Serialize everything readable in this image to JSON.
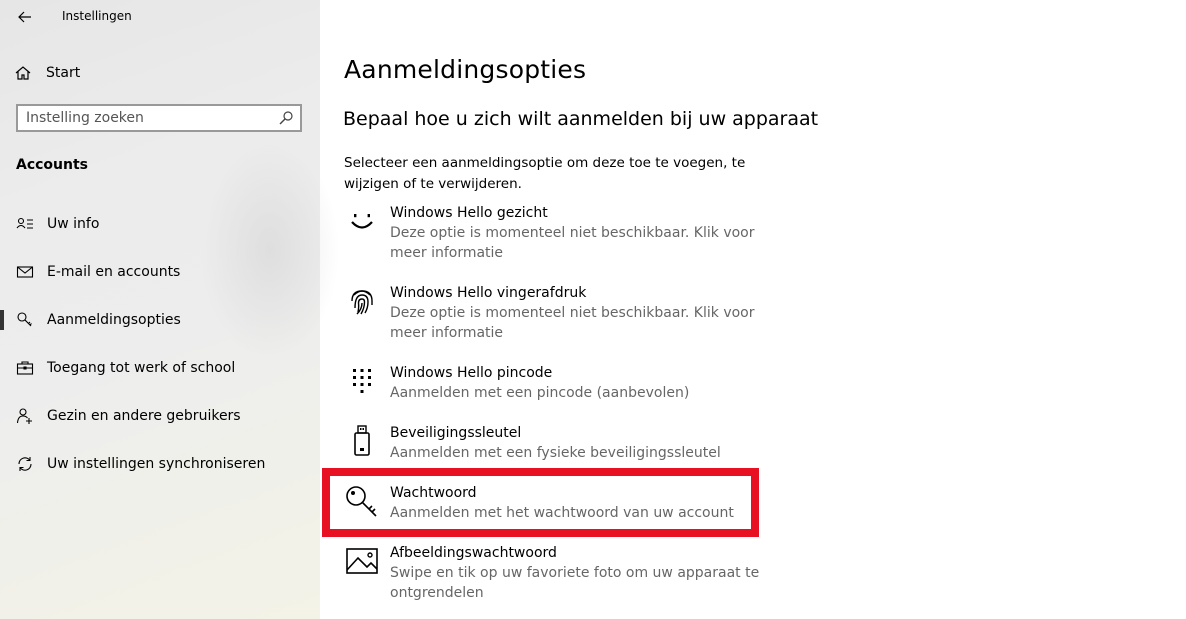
{
  "window": {
    "title": "Instellingen"
  },
  "sidebar": {
    "home_label": "Start",
    "search_placeholder": "Instelling zoeken",
    "section_title": "Accounts",
    "items": [
      {
        "label": "Uw info",
        "icon": "person-list-icon"
      },
      {
        "label": "E-mail en accounts",
        "icon": "mail-icon"
      },
      {
        "label": "Aanmeldingsopties",
        "icon": "key-icon",
        "active": true
      },
      {
        "label": "Toegang tot werk of school",
        "icon": "briefcase-icon"
      },
      {
        "label": "Gezin en andere gebruikers",
        "icon": "person-add-icon"
      },
      {
        "label": "Uw instellingen synchroniseren",
        "icon": "sync-icon"
      }
    ]
  },
  "main": {
    "title": "Aanmeldingsopties",
    "subtitle": "Bepaal hoe u zich wilt aanmelden bij uw apparaat",
    "description": "Selecteer een aanmeldingsoptie om deze toe te voegen, te wijzigen of te verwijderen.",
    "options": [
      {
        "title": "Windows Hello gezicht",
        "subtitle": "Deze optie is momenteel niet beschikbaar. Klik voor meer informatie",
        "icon": "smiley-face-icon"
      },
      {
        "title": "Windows Hello vingerafdruk",
        "subtitle": "Deze optie is momenteel niet beschikbaar. Klik voor meer informatie",
        "icon": "fingerprint-icon"
      },
      {
        "title": "Windows Hello pincode",
        "subtitle": "Aanmelden met een pincode (aanbevolen)",
        "icon": "keypad-icon"
      },
      {
        "title": "Beveiligingssleutel",
        "subtitle": "Aanmelden met een fysieke beveiligingssleutel",
        "icon": "usb-key-icon"
      },
      {
        "title": "Wachtwoord",
        "subtitle": "Aanmelden met het wachtwoord van uw account",
        "icon": "key-icon",
        "highlighted": true
      },
      {
        "title": "Afbeeldingswachtwoord",
        "subtitle": "Swipe en tik op uw favoriete foto om uw apparaat te ontgrendelen",
        "icon": "picture-icon"
      }
    ]
  },
  "colors": {
    "highlight": "#e81123",
    "active_bar": "#333333",
    "subtext": "#666666"
  }
}
